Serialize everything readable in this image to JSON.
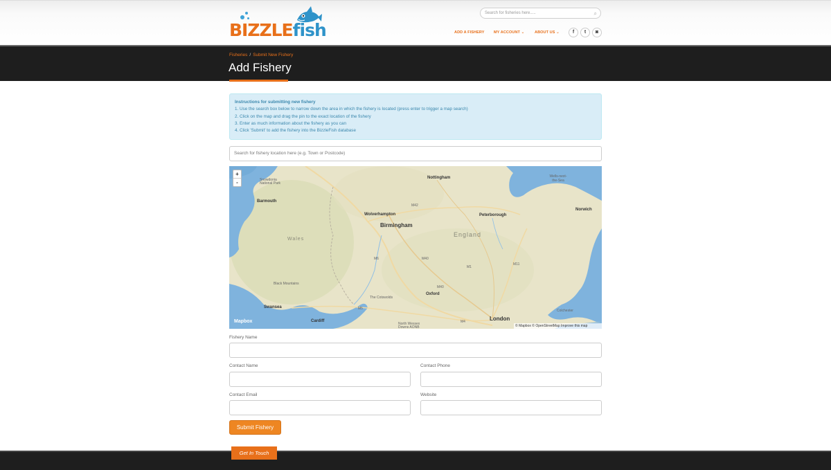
{
  "brand": {
    "logo_part1": "BIZZLE",
    "logo_part2": "fish",
    "accent": "#e8701a",
    "blue": "#2f93c9"
  },
  "header": {
    "search_placeholder": "Search for fisheries here.....",
    "search_icon": "magnifier-icon",
    "nav": {
      "add_fishery": "ADD A FISHERY",
      "my_account": "MY ACCOUNT ⌄",
      "about_us": "ABOUT US ⌄"
    },
    "social": {
      "facebook": "f",
      "twitter": "t",
      "instagram": "◙"
    }
  },
  "breadcrumb": {
    "root": "Fisheries",
    "separator": "/",
    "current": "Submit New Fishery"
  },
  "page_title": "Add Fishery",
  "instructions": {
    "heading": "Instructions for submitting new fishery",
    "steps": [
      "1. Use the search box below to narrow down the area in which the fishery is located (press enter to trigger a map search)",
      "2. Click on the map and drag the pin to the exact location of the fishery",
      "3. Enter as much information about the fishery as you can",
      "4. Click 'Submit' to add the fishery into the BizzleFish database"
    ]
  },
  "location_search": {
    "placeholder": "Search for fishery location here (e.g. Town or Postcode)"
  },
  "map": {
    "zoom_in": "+",
    "zoom_out": "-",
    "logo": "Mapbox",
    "attribution": "© Mapbox © OpenStreetMap Improve this map",
    "places": {
      "nottingham": "Nottingham",
      "wells": "Wells-next-the-Sea",
      "norwich": "Norwich",
      "wolverhampton": "Wolverhampton",
      "birmingham": "Birmingham",
      "peterborough": "Peterborough",
      "england": "England",
      "barmouth": "Barmouth",
      "wales": "Wales",
      "oxford": "Oxford",
      "swansea": "Swansea",
      "cardiff": "Cardiff",
      "london": "London",
      "snowdonia": "Snowdonia National Park",
      "black_mountains": "Black Mountains",
      "cotswolds": "The Cotswolds",
      "north_wessex": "North Wessex Downs AONB",
      "colchester": "Colchester"
    },
    "roads": {
      "m42": "M42",
      "m6": "M6",
      "m40": "M40",
      "m1": "M1",
      "m11": "M11",
      "m5": "M5",
      "m4": "M4",
      "m40b": "M40"
    }
  },
  "form": {
    "fishery_name": "Fishery Name",
    "contact_name": "Contact Name",
    "contact_phone": "Contact Phone",
    "contact_email": "Contact Email",
    "website": "Website",
    "submit": "Submit Fishery"
  },
  "footer": {
    "get_in_touch": "Get In Touch"
  }
}
